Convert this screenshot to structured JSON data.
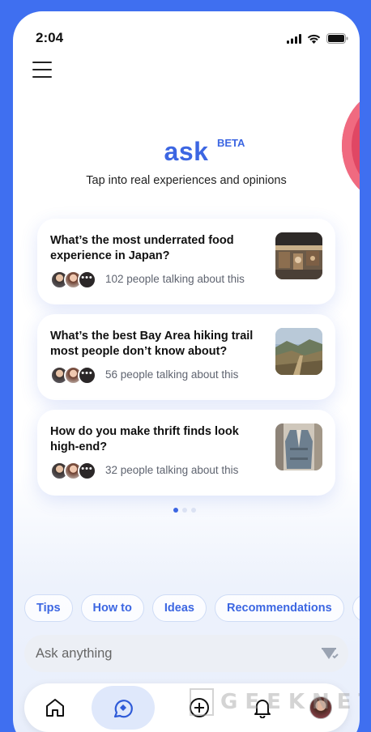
{
  "status_bar": {
    "time": "2:04"
  },
  "brand": {
    "word": "ask",
    "badge": "BETA",
    "tagline": "Tap into real experiences and opinions"
  },
  "cards": [
    {
      "question": "What’s the most underrated food experience in Japan?",
      "count_text": "102 people talking about this",
      "avatar_more": "•••"
    },
    {
      "question": "What’s the best Bay Area hiking trail most people don’t know about?",
      "count_text": "56 people talking about this",
      "avatar_more": "•••"
    },
    {
      "question": "How do you make thrift finds look high-end?",
      "count_text": "32 people talking about this",
      "avatar_more": "•••"
    }
  ],
  "carousel": {
    "page_count": 3,
    "active_index": 0
  },
  "chips": [
    "Tips",
    "How to",
    "Ideas",
    "Recommendations"
  ],
  "ask_bar": {
    "placeholder": "Ask anything"
  },
  "nav": {
    "items": [
      "home-icon",
      "ask-chat-icon",
      "add-icon",
      "bell-icon",
      "profile-avatar"
    ]
  },
  "watermark": "GEEKNETIC",
  "colors": {
    "accent": "#3c66e2",
    "background": "#3f6ff0",
    "chip_border": "#cfdcf6",
    "nav_active": "#dfe8fb"
  }
}
